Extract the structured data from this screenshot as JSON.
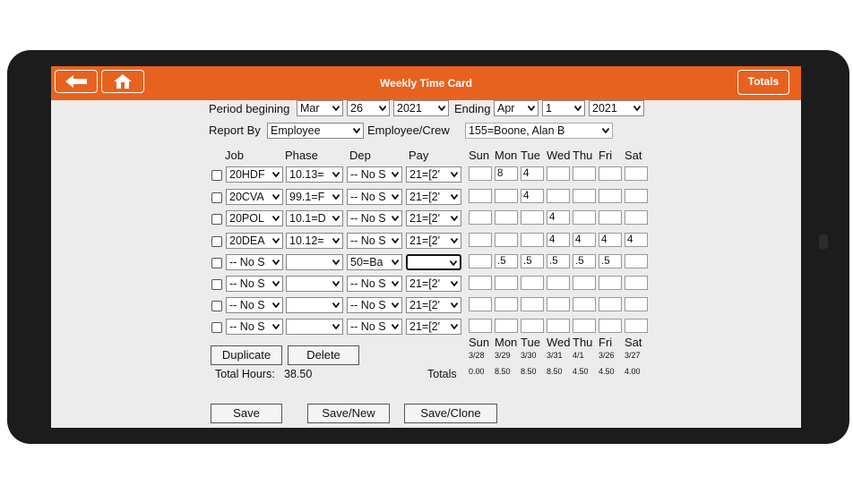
{
  "app": {
    "title": "Weekly Time Card",
    "totals_button": "Totals",
    "accent": "#e8621f"
  },
  "period": {
    "label": "Period begining",
    "month": "Mar",
    "day": "26",
    "year": "2021",
    "ending_label": "Ending",
    "end_month": "Apr",
    "end_day": "1",
    "end_year": "2021"
  },
  "report": {
    "label": "Report By",
    "by": "Employee",
    "crew_label": "Employee/Crew",
    "employee": "155=Boone, Alan B"
  },
  "columns": {
    "job": "Job",
    "phase": "Phase",
    "dep": "Dep",
    "pay": "Pay",
    "days": [
      "Sun",
      "Mon",
      "Tue",
      "Wed",
      "Thu",
      "Fri",
      "Sat"
    ]
  },
  "rows": [
    {
      "job": "20HDF",
      "phase": "10.13=",
      "dep": "-- No S",
      "pay": "21=[2'",
      "hours": [
        "",
        "8",
        "4",
        "",
        "",
        "",
        ""
      ]
    },
    {
      "job": "20CVA",
      "phase": "99.1=F",
      "dep": "-- No S",
      "pay": "21=[2'",
      "hours": [
        "",
        "",
        "4",
        "",
        "",
        "",
        ""
      ]
    },
    {
      "job": "20POL",
      "phase": "10.1=D",
      "dep": "-- No S",
      "pay": "21=[2'",
      "hours": [
        "",
        "",
        "",
        "4",
        "",
        "",
        ""
      ]
    },
    {
      "job": "20DEA",
      "phase": "10.12=",
      "dep": "-- No S",
      "pay": "21=[2'",
      "hours": [
        "",
        "",
        "",
        "4",
        "4",
        "4",
        "4"
      ]
    },
    {
      "job": "-- No S",
      "phase": "",
      "dep": "50=Ba",
      "pay": "",
      "hours": [
        "",
        ".5",
        ".5",
        ".5",
        ".5",
        ".5",
        ""
      ]
    },
    {
      "job": "-- No S",
      "phase": "",
      "dep": "-- No S",
      "pay": "21=[2'",
      "hours": [
        "",
        "",
        "",
        "",
        "",
        "",
        ""
      ]
    },
    {
      "job": "-- No S",
      "phase": "",
      "dep": "-- No S",
      "pay": "21=[2'",
      "hours": [
        "",
        "",
        "",
        "",
        "",
        "",
        ""
      ]
    },
    {
      "job": "-- No S",
      "phase": "",
      "dep": "-- No S",
      "pay": "21=[2'",
      "hours": [
        "",
        "",
        "",
        "",
        "",
        "",
        ""
      ]
    }
  ],
  "summary": {
    "days": [
      "Sun",
      "Mon",
      "Tue",
      "Wed",
      "Thu",
      "Fri",
      "Sat"
    ],
    "dates": [
      "3/28",
      "3/29",
      "3/30",
      "3/31",
      "4/1",
      "3/26",
      "3/27"
    ],
    "totals_label": "Totals",
    "totals": [
      "0.00",
      "8.50",
      "8.50",
      "8.50",
      "4.50",
      "4.50",
      "4.00"
    ],
    "total_hours_label": "Total Hours:",
    "total_hours": "38.50"
  },
  "actions": {
    "duplicate": "Duplicate",
    "delete": "Delete",
    "save": "Save",
    "save_new": "Save/New",
    "save_clone": "Save/Clone"
  }
}
